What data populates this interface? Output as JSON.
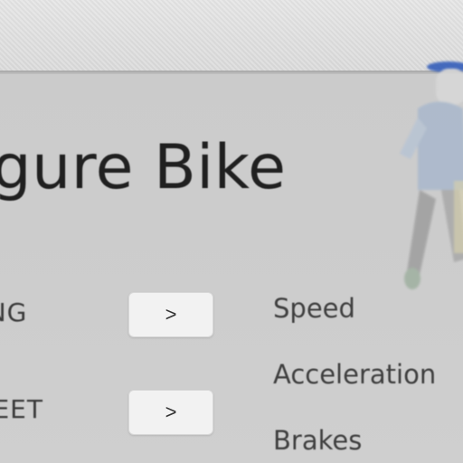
{
  "config": {
    "title": "nfigure Bike",
    "rows": [
      {
        "label": "RING",
        "button_label": ">"
      },
      {
        "label": "REET",
        "button_label": ">"
      }
    ],
    "stats": [
      "Speed",
      "Acceleration",
      "Brakes"
    ]
  },
  "colors": {
    "panel": "#cbcbcb",
    "button": "#f2f2f2",
    "rider_cap": "#2a56b8"
  }
}
